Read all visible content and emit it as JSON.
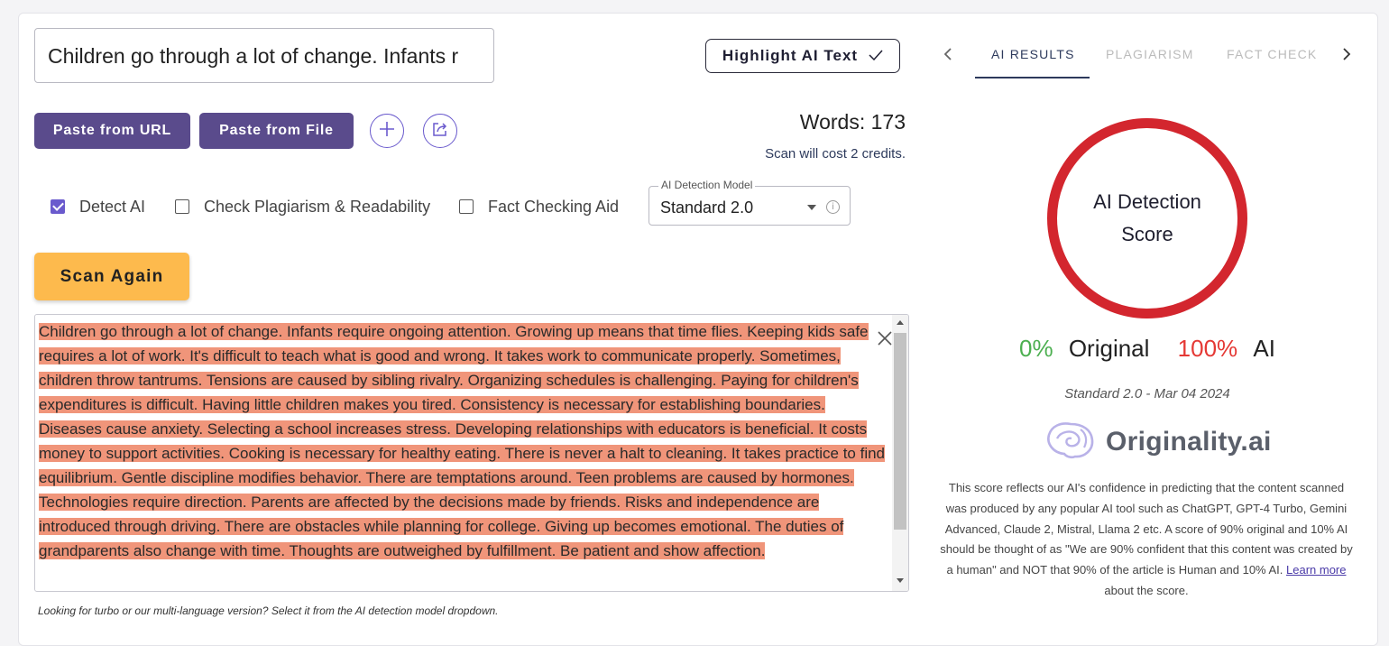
{
  "title_input": {
    "value": "Children go through a lot of change. Infants r"
  },
  "toolbar": {
    "highlight_label": "Highlight AI Text",
    "paste_url_label": "Paste from URL",
    "paste_file_label": "Paste from File",
    "add_icon": "plus-icon",
    "share_icon": "share-icon"
  },
  "stats": {
    "words_label": "Words: 173",
    "credits_prefix": "Scan will cost ",
    "credits_link": "2 credits",
    "credits_suffix": "."
  },
  "options": {
    "detect_ai": {
      "label": "Detect AI",
      "checked": true
    },
    "plagiarism": {
      "label": "Check Plagiarism & Readability",
      "checked": false
    },
    "fact_check": {
      "label": "Fact Checking Aid",
      "checked": false
    }
  },
  "model_select": {
    "legend": "AI Detection Model",
    "value": "Standard 2.0"
  },
  "scan_label": "Scan Again",
  "content": {
    "text": "Children go through a lot of change. Infants require ongoing attention. Growing up means that time flies. Keeping kids safe requires a lot of work. It's difficult to teach what is good and wrong. It takes work to communicate properly. Sometimes, children throw tantrums. Tensions are caused by sibling rivalry. Organizing schedules is challenging. Paying for children's expenditures is difficult. Having little children makes you tired. Consistency is necessary for establishing boundaries. Diseases cause anxiety. Selecting a school increases stress. Developing relationships with educators is beneficial. It costs money to support activities. Cooking is necessary for healthy eating. There is never a halt to cleaning. It takes practice to find equilibrium. Gentle discipline modifies behavior. There are temptations around. Teen problems are caused by hormones. Technologies require direction. Parents are affected by the decisions made by friends. Risks and independence are introduced through driving. There are obstacles while planning for college. Giving up becomes emotional. The duties of grandparents also change with time. Thoughts are outweighed by fulfillment. Be patient and show affection."
  },
  "hint": "Looking for turbo or our multi-language version? Select it from the AI detection model dropdown.",
  "tabs": [
    {
      "label": "AI RESULTS",
      "active": true
    },
    {
      "label": "PLAGIARISM",
      "active": false
    },
    {
      "label": "FACT CHECK",
      "active": false
    }
  ],
  "score": {
    "ring_title": "AI Detection Score",
    "original_pct": "0%",
    "original_label": "Original",
    "ai_pct": "100%",
    "ai_label": "AI",
    "model_date": "Standard 2.0 - Mar 04 2024",
    "ring_color": "#d3262e"
  },
  "brand": {
    "name": "Originality.ai",
    "icon": "brain-icon"
  },
  "disclaimer": {
    "text": "This score reflects our AI's confidence in predicting that the content scanned was produced by any popular AI tool such as ChatGPT, GPT-4 Turbo, Gemini Advanced, Claude 2, Mistral, Llama 2 etc. A score of 90% original and 10% AI should be thought of as \"We are 90% confident that this content was created by a human\" and NOT that 90% of the article is Human and 10% AI. ",
    "link": "Learn more",
    "suffix": " about the score."
  },
  "colors": {
    "accent_purple": "#5a4b8c",
    "scan_yellow": "#fdba4d",
    "highlight": "#f0957a",
    "original_green": "#4caf50",
    "ai_red": "#e53935"
  }
}
